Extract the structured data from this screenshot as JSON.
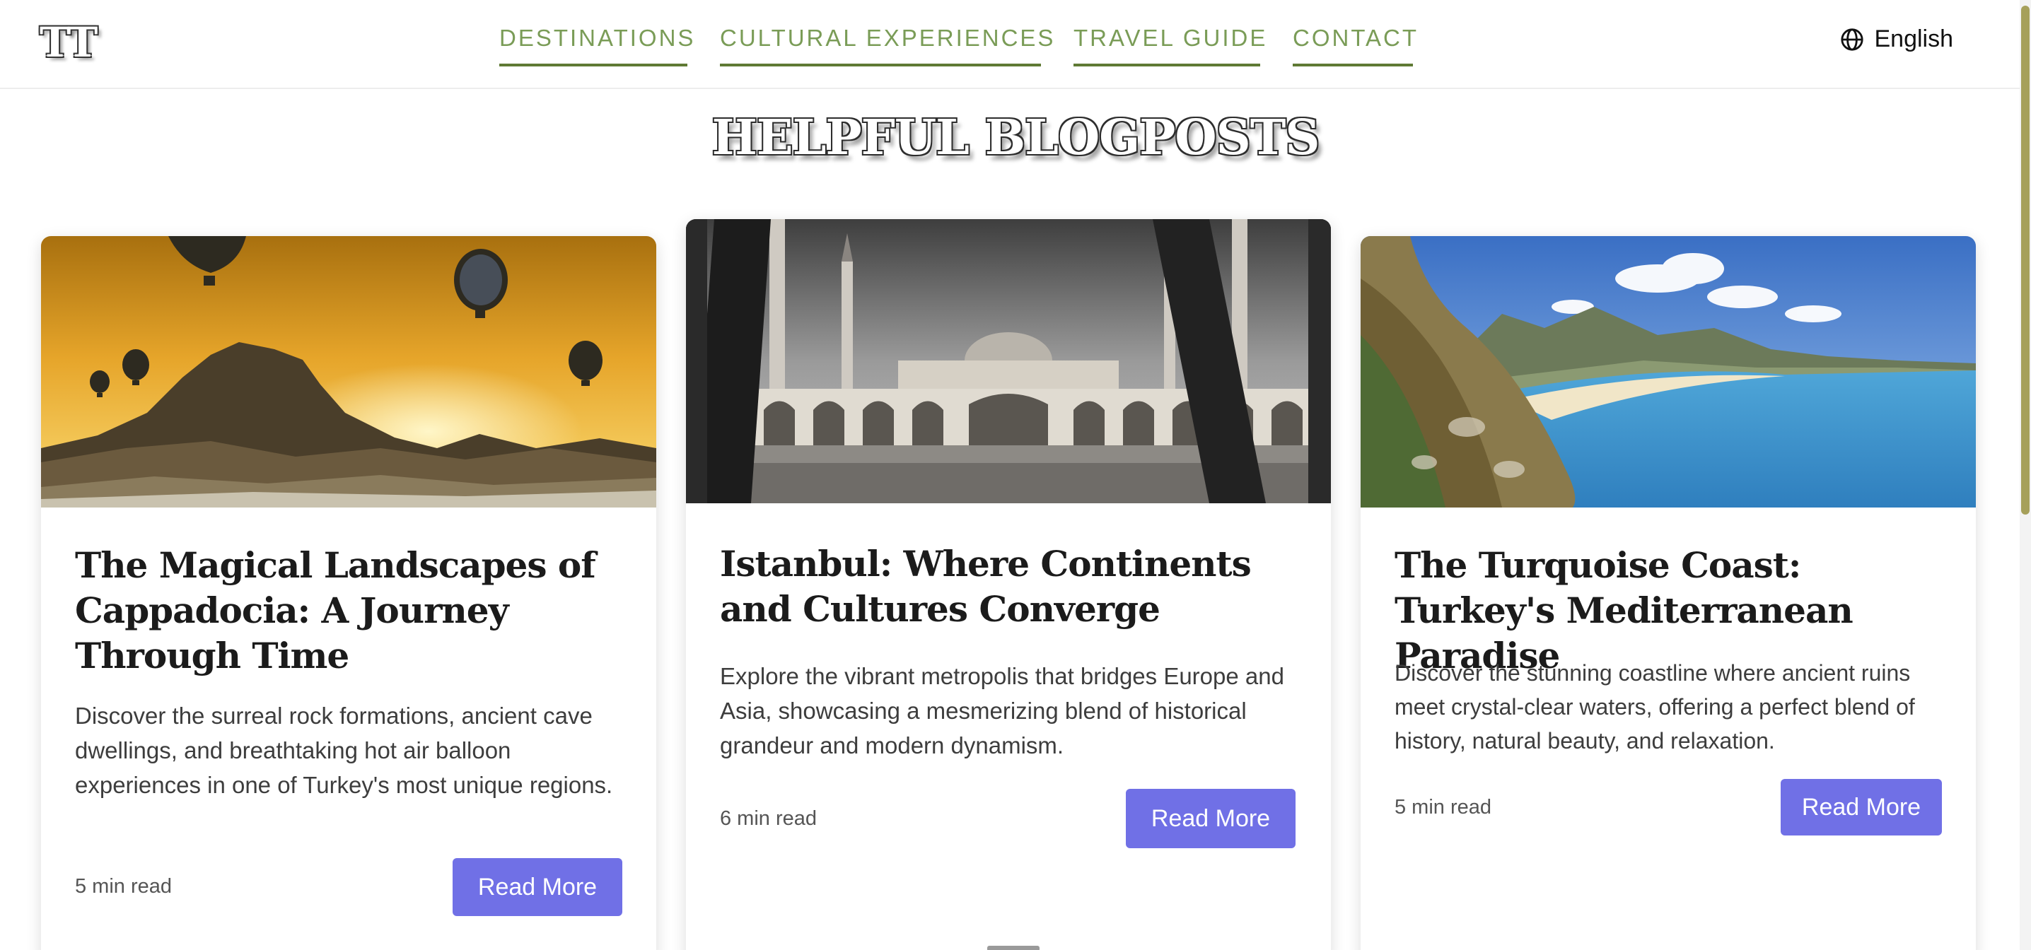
{
  "header": {
    "logo_text": "TT",
    "nav": [
      {
        "label": "DESTINATIONS"
      },
      {
        "label": "CULTURAL EXPERIENCES"
      },
      {
        "label": "TRAVEL GUIDE"
      },
      {
        "label": "CONTACT"
      }
    ],
    "language": "English",
    "language_icon": "globe-icon"
  },
  "main": {
    "title": "HELPFUL BLOGPOSTS",
    "posts": [
      {
        "title": "The Magical Landscapes of Cappadocia: A Journey Through Time",
        "description": "Discover the surreal rock formations, ancient cave dwellings, and breathtaking hot air balloon experiences in one of Turkey's most unique regions.",
        "read_time": "5 min read",
        "button_label": "Read More",
        "image": "cappadocia-balloons-sunset"
      },
      {
        "title": "Istanbul: Where Continents and Cultures Converge",
        "description": "Explore the vibrant metropolis that bridges Europe and Asia, showcasing a mesmerizing blend of historical grandeur and modern dynamism.",
        "read_time": "6 min read",
        "button_label": "Read More",
        "image": "istanbul-mosque-courtyard"
      },
      {
        "title": "The Turquoise Coast: Turkey's Mediterranean Paradise",
        "description": "Discover the stunning coastline where ancient ruins meet crystal-clear waters, offering a perfect blend of history, natural beauty, and relaxation.",
        "read_time": "5 min read",
        "button_label": "Read More",
        "image": "turquoise-coast-beach"
      }
    ]
  },
  "colors": {
    "nav_text": "#7a9c57",
    "nav_underline": "#5f7a34",
    "button_bg": "#7070e6",
    "scroll_thumb": "#a6a05a"
  }
}
